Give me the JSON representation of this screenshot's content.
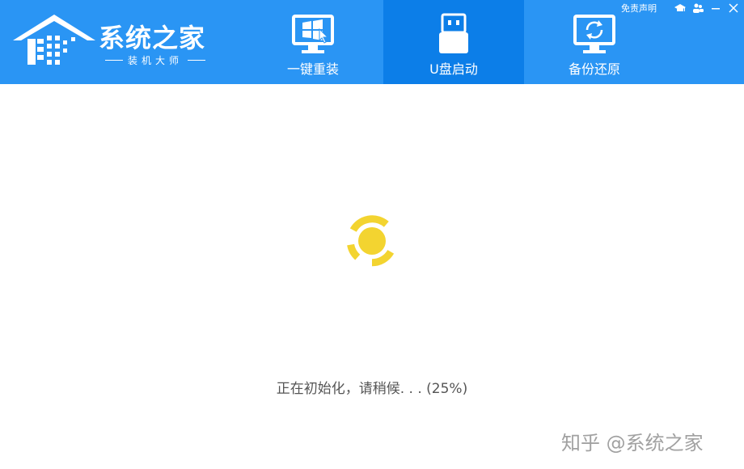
{
  "brand": {
    "title": "系统之家",
    "subtitle": "装机大师"
  },
  "header": {
    "disclaimer": "免责声明",
    "icons": [
      "graduation-cap-icon",
      "users-icon",
      "minimize-icon",
      "close-icon"
    ]
  },
  "nav": {
    "tabs": [
      {
        "label": "一键重装",
        "icon": "windows-monitor-icon",
        "active": false
      },
      {
        "label": "U盘启动",
        "icon": "usb-drive-icon",
        "active": true
      },
      {
        "label": "备份还原",
        "icon": "backup-restore-icon",
        "active": false
      }
    ]
  },
  "status": {
    "text": "正在初始化，请稍候. . . (25%)",
    "progress_percent": 25
  },
  "watermark": "知乎 @系统之家",
  "colors": {
    "header_bg": "#2a95f4",
    "active_tab_bg": "#0c7ee8",
    "spinner": "#f3d430"
  }
}
